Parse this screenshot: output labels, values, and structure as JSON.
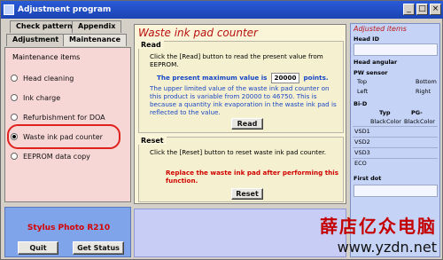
{
  "window": {
    "title": "Adjustment program",
    "controls": {
      "minimize": "_",
      "maximize": "□",
      "close": "×"
    }
  },
  "tabs": {
    "check_pattern": "Check pattern",
    "appendix": "Appendix",
    "adjustment": "Adjustment",
    "maintenance": "Maintenance"
  },
  "maintenance": {
    "header": "Maintenance items",
    "items": [
      {
        "label": "Head cleaning"
      },
      {
        "label": "Ink charge"
      },
      {
        "label": "Refurbishment for DOA"
      },
      {
        "label": "Waste ink pad counter"
      },
      {
        "label": "EEPROM data copy"
      }
    ],
    "selected_index": 3
  },
  "footer_left": {
    "model": "Stylus Photo R210",
    "quit_label": "Quit",
    "status_label": "Get Status"
  },
  "main": {
    "title": "Waste ink pad counter",
    "read": {
      "group_title": "Read",
      "instruction": "Click the [Read] button to read the present value from EEPROM.",
      "present_prefix": "The present maximum value is",
      "present_value": "20000",
      "present_suffix": "points.",
      "upper_limit_text": "The upper limited value of the waste ink pad counter on this product is variable from 20000 to 46750. This is because a quantity ink evaporation in the waste ink pad is reflected to the value.",
      "button": "Read"
    },
    "reset": {
      "group_title": "Reset",
      "instruction": "Click the [Reset] button to reset waste ink pad counter.",
      "warning": "Replace the waste ink pad after performing this function.",
      "button": "Reset"
    }
  },
  "adjusted_items": {
    "title": "Adjusted items",
    "head_id": "Head ID",
    "head_angular": "Head angular",
    "pw_sensor": "PW sensor",
    "pw_labels": {
      "top_left": "Top",
      "top_right": "Bottom",
      "bottom_left": "Left",
      "bottom_right": "Right"
    },
    "bi_d": "Bi-D",
    "bi_d_typ": "Typ",
    "bi_d_pg": "PG-",
    "bi_d_cols": {
      "black": "Black",
      "color": "Color",
      "black2": "Black",
      "color2": "Color"
    },
    "rows": [
      "VSD1",
      "VSD2",
      "VSD3",
      "ECO"
    ],
    "first_dot": "First dot"
  },
  "watermark": {
    "line1": "薛店亿众电脑",
    "line2": "www.yzdn.net"
  }
}
